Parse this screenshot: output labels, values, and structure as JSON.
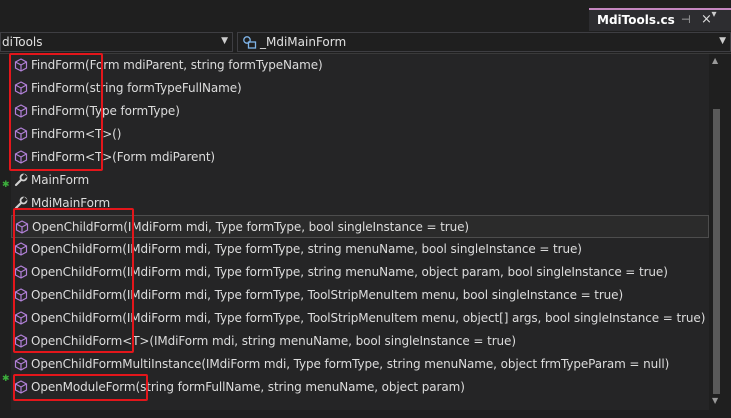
{
  "tab": {
    "title": "MdiTools.cs",
    "pin": "⊣",
    "close": "×",
    "overflow": "▾"
  },
  "nav": {
    "left_value": "diTools",
    "right_value": "_MdiMainForm"
  },
  "items": [
    {
      "label": "FindForm(Form mdiParent, string formTypeName)",
      "icon": "method-icon"
    },
    {
      "label": "FindForm(string formTypeFullName)",
      "icon": "method-icon"
    },
    {
      "label": "FindForm(Type formType)",
      "icon": "method-icon"
    },
    {
      "label": "FindForm<T>()",
      "icon": "method-icon"
    },
    {
      "label": "FindForm<T>(Form mdiParent)",
      "icon": "method-icon"
    },
    {
      "label": "MainForm",
      "icon": "wrench-icon"
    },
    {
      "label": "MdiMainForm",
      "icon": "wrench-icon"
    },
    {
      "label": "OpenChildForm(IMdiForm mdi, Type formType, bool singleInstance = true)",
      "icon": "method-icon",
      "selected": true
    },
    {
      "label": "OpenChildForm(IMdiForm mdi, Type formType, string menuName, bool singleInstance = true)",
      "icon": "method-icon"
    },
    {
      "label": "OpenChildForm(IMdiForm mdi, Type formType, string menuName, object param, bool singleInstance = true)",
      "icon": "method-icon"
    },
    {
      "label": "OpenChildForm(IMdiForm mdi, Type formType, ToolStripMenuItem menu, bool singleInstance = true)",
      "icon": "method-icon"
    },
    {
      "label": "OpenChildForm(IMdiForm mdi, Type formType, ToolStripMenuItem menu, object[] args, bool singleInstance = true)",
      "icon": "method-icon"
    },
    {
      "label": "OpenChildForm<T>(IMdiForm mdi, string menuName, bool singleInstance = true)",
      "icon": "method-icon"
    },
    {
      "label": "OpenChildFormMultiInstance(IMdiForm mdi, Type formType, string menuName, object frmTypeParam = null)",
      "icon": "method-icon"
    },
    {
      "label": "OpenModuleForm(string formFullName, string menuName, object param)",
      "icon": "method-icon"
    }
  ],
  "colors": {
    "method_icon": "#b180d7",
    "highlight_box": "#e3161b",
    "star": "#3cae3c"
  }
}
